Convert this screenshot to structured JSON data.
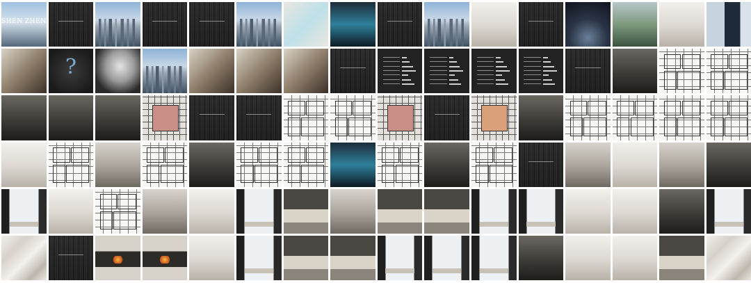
{
  "gallery": {
    "title_tile_text": "SHEN ZHEN",
    "question_tile_glyph": "?",
    "tiles": [
      "title",
      "dark",
      "city",
      "dark",
      "dark",
      "city",
      "map",
      "aqua",
      "dark",
      "city",
      "interior-light",
      "dark",
      "night",
      "green",
      "interior-light",
      "suit",
      "people",
      "question",
      "sculpt",
      "city",
      "people",
      "people",
      "people",
      "dark",
      "data",
      "data",
      "data",
      "data",
      "dark",
      "interior-dark",
      "plan",
      "plan",
      "interior-dark",
      "interior-dark",
      "interior-dark",
      "plan-color",
      "dark",
      "dark",
      "plan",
      "plan",
      "plan-color",
      "dark",
      "plan-orange",
      "interior-dark",
      "plan",
      "plan",
      "plan",
      "plan",
      "interior-light",
      "plan",
      "interior-mid",
      "plan",
      "interior-dark",
      "plan",
      "plan",
      "aqua",
      "plan",
      "interior-dark",
      "plan",
      "dark",
      "interior-mid",
      "interior-light",
      "interior-mid",
      "interior-dark",
      "window",
      "interior-light",
      "plan",
      "interior-mid",
      "interior-light",
      "window",
      "bed",
      "interior-mid",
      "bed",
      "bed",
      "window",
      "window",
      "interior-light",
      "interior-light",
      "interior-dark",
      "window",
      "marble",
      "dark",
      "fire",
      "fire",
      "interior-light",
      "window",
      "bed",
      "bed",
      "window",
      "window",
      "window",
      "interior-dark",
      "interior-light",
      "interior-light",
      "bed",
      "marble"
    ]
  }
}
